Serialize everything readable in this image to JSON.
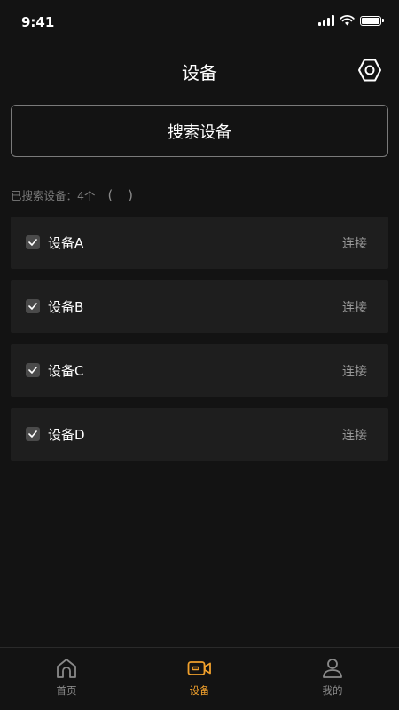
{
  "status_bar": {
    "time": "9:41"
  },
  "header": {
    "title": "设备"
  },
  "search": {
    "button_label": "搜索设备"
  },
  "found": {
    "label": "已搜索设备：4个",
    "spinner": "( )"
  },
  "devices": [
    {
      "name": "设备A",
      "checked": true,
      "action": "连接"
    },
    {
      "name": "设备B",
      "checked": true,
      "action": "连接"
    },
    {
      "name": "设备C",
      "checked": true,
      "action": "连接"
    },
    {
      "name": "设备D",
      "checked": true,
      "action": "连接"
    }
  ],
  "tabs": [
    {
      "label": "首页",
      "icon": "home-icon",
      "active": false
    },
    {
      "label": "设备",
      "icon": "camera-icon",
      "active": true
    },
    {
      "label": "我的",
      "icon": "person-icon",
      "active": false
    }
  ],
  "colors": {
    "accent": "#f0a02c",
    "background": "#131313",
    "card": "#1e1e1e"
  }
}
